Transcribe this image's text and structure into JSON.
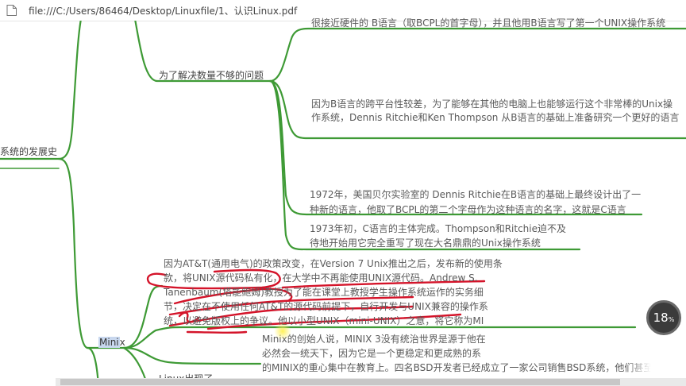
{
  "browser": {
    "url": "file:///C:/Users/86464/Desktop/Linuxfile/1、认识Linux.pdf",
    "page_icon": "document-icon"
  },
  "mindmap": {
    "root_partial": "系统的发展史",
    "topics": {
      "solve_problem": "为了解决数量不够的问题",
      "minix_prefix": "Mini",
      "minix_suffix": "x",
      "cut_bottom": "Linux出现了"
    },
    "notes": {
      "b_language": "很接近硬件的 B语言（取BCPL的首字母），并且他用B语言写了第一个UNIX操作系统",
      "cross_platform_1": "因为B语言的跨平台性较差，为了能够在其他的电脑上也能够运行这个非常棒的Unix操",
      "cross_platform_2": "作系统，Dennis Ritchie和Ken Thompson 从B语言的基础上准备研究一个更好的语言",
      "c_lang_1": "1972年，美国贝尔实验室的 Dennis Ritchie在B语言的基础上最终设计出了一",
      "c_lang_2": "种新的语言，他取了BCPL的第二个字母作为这种语言的名字，这就是C语言",
      "c_done_1": "1973年初，C语言的主体完成。Thompson和Ritchie迫不及",
      "c_done_2": "待地开始用它完全重写了现在大名鼎鼎的Unix操作系统",
      "att_1": "因为AT&T(通用电气)的政策改变，在Version 7 Unix推出之后，发布新的使用条",
      "att_2": "款，将UNIX源代码私有化，在大学中不再能使用UNIX源代码。Andrew S.",
      "att_3": "Tanenbaum(塔能鲍姆)教授为了能在课堂上教授学生操作系统运作的实务细",
      "att_4": "节，决定在不使用任何AT&T的源代码前提下，自行开发与UNIX兼容的操作系",
      "att_5": "统，以避免版权上的争议。他以小型UNIX（mini-UNIX）之意，将它称为MI",
      "minix_1": "Minix的创始人说，MINIX 3没有统治世界是源于他在",
      "minix_2": "必然会一统天下，因为它是一个更稳定和更成熟的系",
      "minix_3": "的MINIX的重心集中在教育上。四名BSD开发者已经成立了一家公司销售BSD系统，他们甚至"
    }
  },
  "overlay": {
    "percent": "18",
    "percent_unit": "%"
  },
  "colors": {
    "branch": "#3e9a35",
    "annotation": "#d4142a",
    "highlight": "#c8d7ee"
  }
}
